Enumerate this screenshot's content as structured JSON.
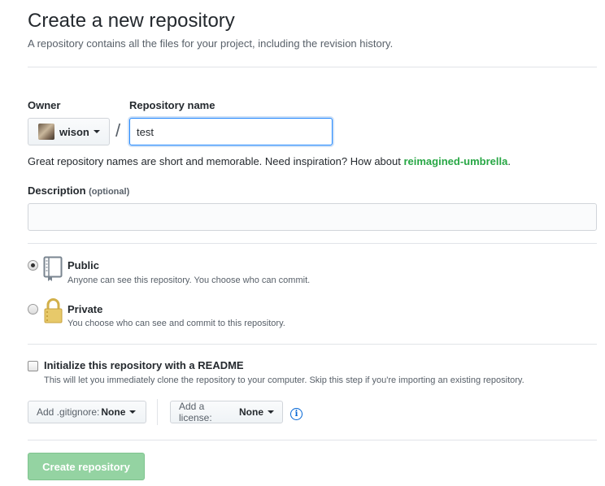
{
  "header": {
    "title": "Create a new repository",
    "subtitle": "A repository contains all the files for your project, including the revision history."
  },
  "owner": {
    "label": "Owner",
    "value": "wison"
  },
  "separator": "/",
  "repo_name": {
    "label": "Repository name",
    "value": "test"
  },
  "hint": {
    "text": "Great repository names are short and memorable. Need inspiration? How about ",
    "suggestion": "reimagined-umbrella",
    "suffix": "."
  },
  "description": {
    "label": "Description",
    "optional": "(optional)",
    "value": ""
  },
  "visibility": {
    "public": {
      "title": "Public",
      "desc": "Anyone can see this repository. You choose who can commit.",
      "selected": true
    },
    "private": {
      "title": "Private",
      "desc": "You choose who can see and commit to this repository.",
      "selected": false
    }
  },
  "readme": {
    "label": "Initialize this repository with a README",
    "desc": "This will let you immediately clone the repository to your computer. Skip this step if you're importing an existing repository.",
    "checked": false
  },
  "gitignore": {
    "prefix": "Add .gitignore:",
    "value": "None"
  },
  "license": {
    "prefix": "Add a license:",
    "value": "None"
  },
  "info_icon": "info-icon",
  "submit": {
    "label": "Create repository",
    "enabled": false
  },
  "colors": {
    "accent_blue": "#0366d6",
    "suggestion_green": "#28a745",
    "submit_disabled": "#94d3a2"
  }
}
